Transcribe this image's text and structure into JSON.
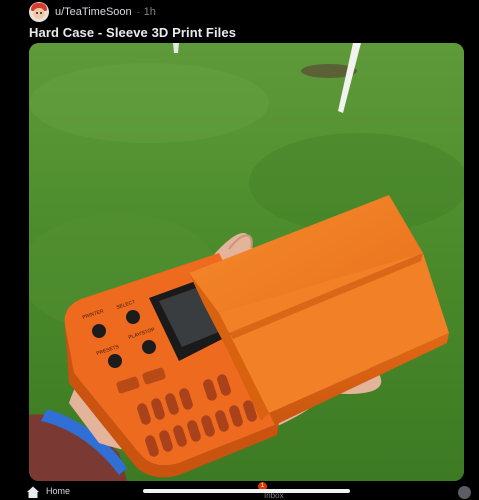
{
  "post": {
    "author": "u/TeaTimeSoon",
    "separator": "·",
    "time": "1h",
    "title": "Hard Case - Sleeve 3D Print Files"
  },
  "device": {
    "labels": {
      "printer": "PRINTER",
      "select": "SELECT",
      "presets": "PRESETS",
      "play_stop": "PLAY/STOP"
    }
  },
  "nav": {
    "home_label": "Home",
    "inbox_label": "Inbox",
    "inbox_badge": "1"
  },
  "colors": {
    "background": "#000000",
    "accent": "#d93a00",
    "case_orange": "#f07a1c"
  }
}
